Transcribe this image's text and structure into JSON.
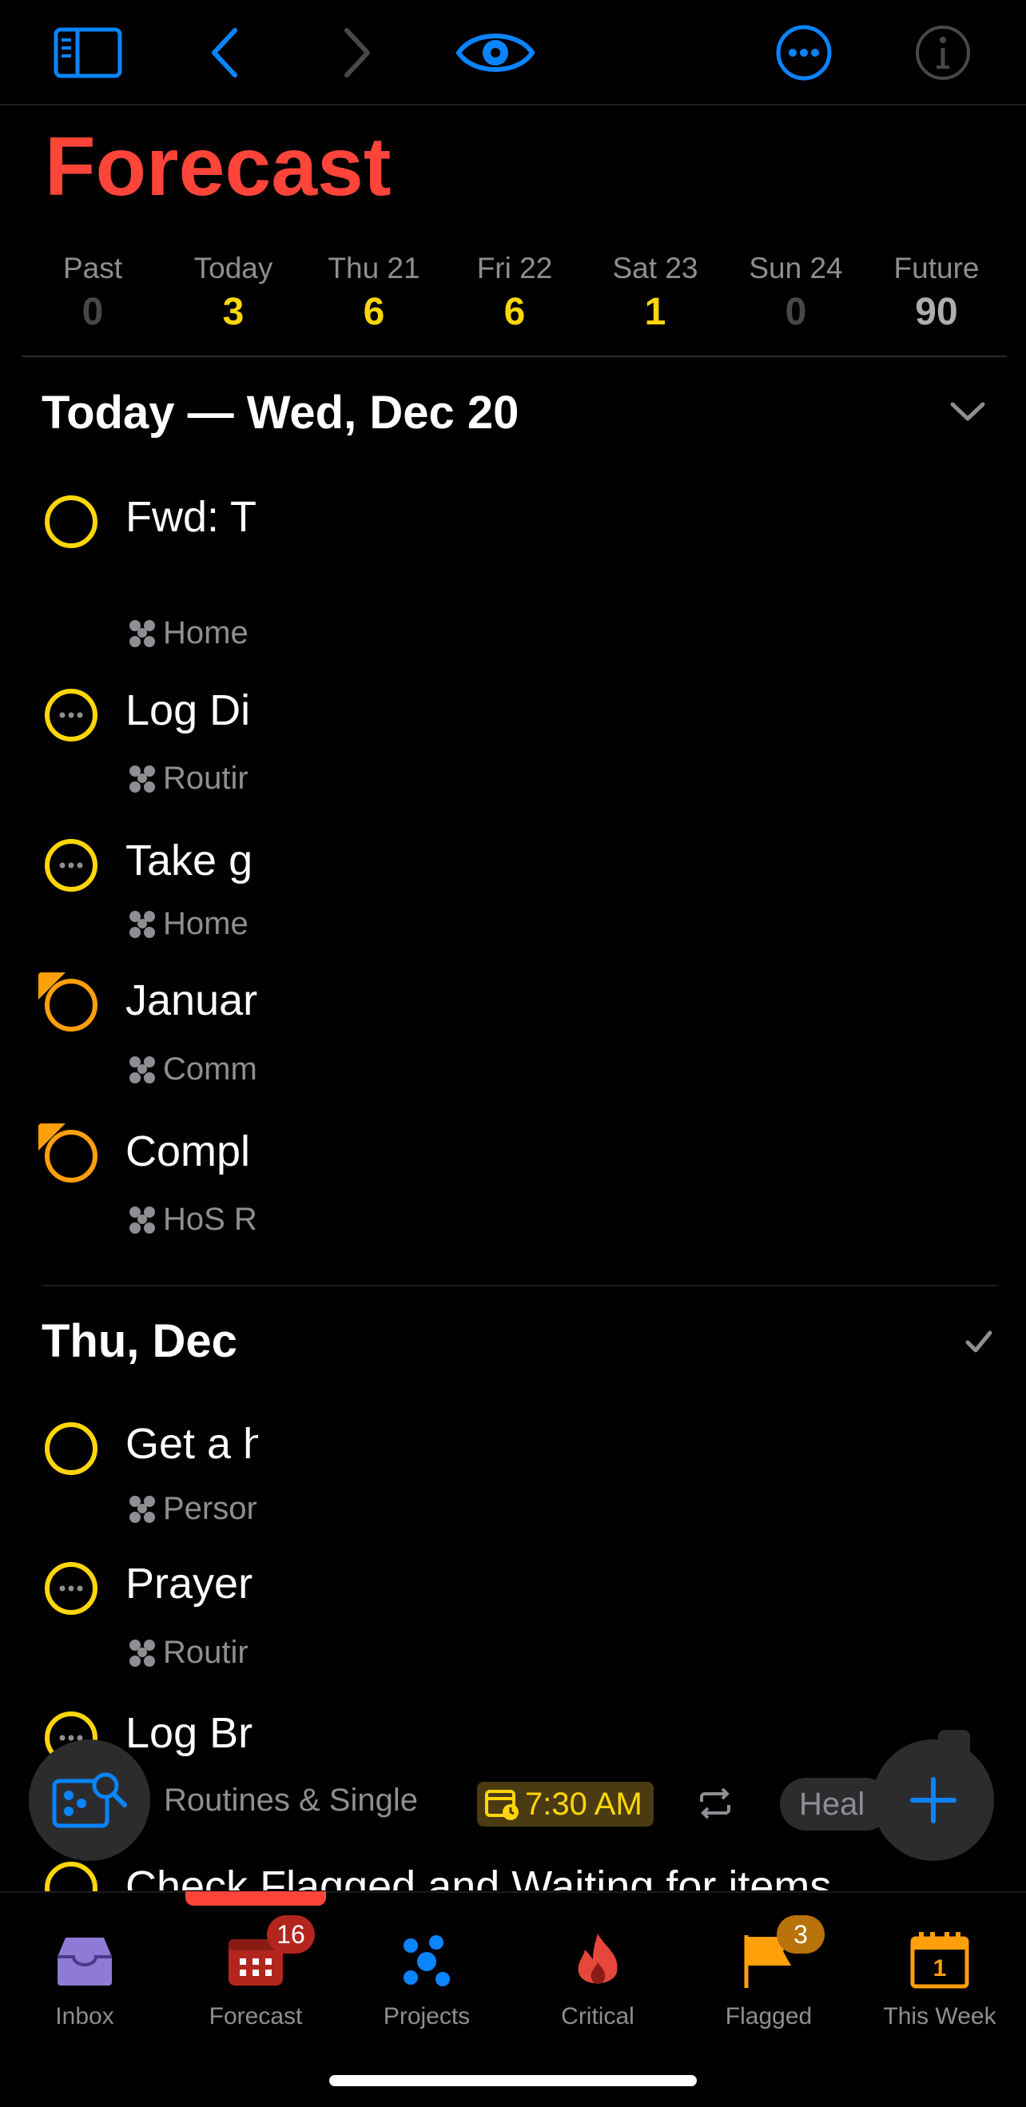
{
  "colors": {
    "accent_red": "#ff453a",
    "accent_blue": "#0a84ff",
    "due_yellow": "#ffd60a",
    "flag_orange": "#ff9f0a",
    "secondary_text": "#8e8e93"
  },
  "page": {
    "title": "Forecast"
  },
  "strip": [
    {
      "label": "Past",
      "count": "0",
      "color": "#48484a"
    },
    {
      "label": "Today",
      "count": "3",
      "color": "#ffd60a"
    },
    {
      "label": "Thu 21",
      "count": "6",
      "color": "#ffd60a"
    },
    {
      "label": "Fri 22",
      "count": "6",
      "color": "#ffd60a"
    },
    {
      "label": "Sat 23",
      "count": "1",
      "color": "#ffd60a"
    },
    {
      "label": "Sun 24",
      "count": "0",
      "color": "#48484a"
    },
    {
      "label": "Future",
      "count": "90",
      "color": "#aeaeb2"
    }
  ],
  "sections": {
    "today": {
      "title": "Today — Wed, Dec 20"
    },
    "thu": {
      "title": "Thu, Dec"
    }
  },
  "tasks_today": [
    {
      "title": "Fwd: T",
      "meta": "Home"
    },
    {
      "title": "Log Di",
      "meta": "Routir"
    },
    {
      "title": "Take g",
      "meta": "Home"
    },
    {
      "title": "Januar",
      "meta": "Comm"
    },
    {
      "title": "Compl",
      "meta": "HoS R"
    }
  ],
  "tasks_thu": [
    {
      "title": "Get a h",
      "meta": "Persor"
    },
    {
      "title": "Prayer",
      "meta": "Routir"
    },
    {
      "title": "Log Br"
    }
  ],
  "bottom_row": {
    "meta": "Routines & Single",
    "time": "7:30 AM",
    "tag": "Heal"
  },
  "peek_task": "Check Flagged and Waiting for items",
  "tabbar": [
    {
      "label": "Inbox",
      "icon": "inbox-icon"
    },
    {
      "label": "Forecast",
      "icon": "calendar-icon",
      "badge": "16"
    },
    {
      "label": "Projects",
      "icon": "projects-icon"
    },
    {
      "label": "Critical",
      "icon": "flame-icon"
    },
    {
      "label": "Flagged",
      "icon": "flag-icon",
      "badge": "3"
    },
    {
      "label": "This Week",
      "icon": "this-week-icon"
    }
  ],
  "this_week_day": "1"
}
